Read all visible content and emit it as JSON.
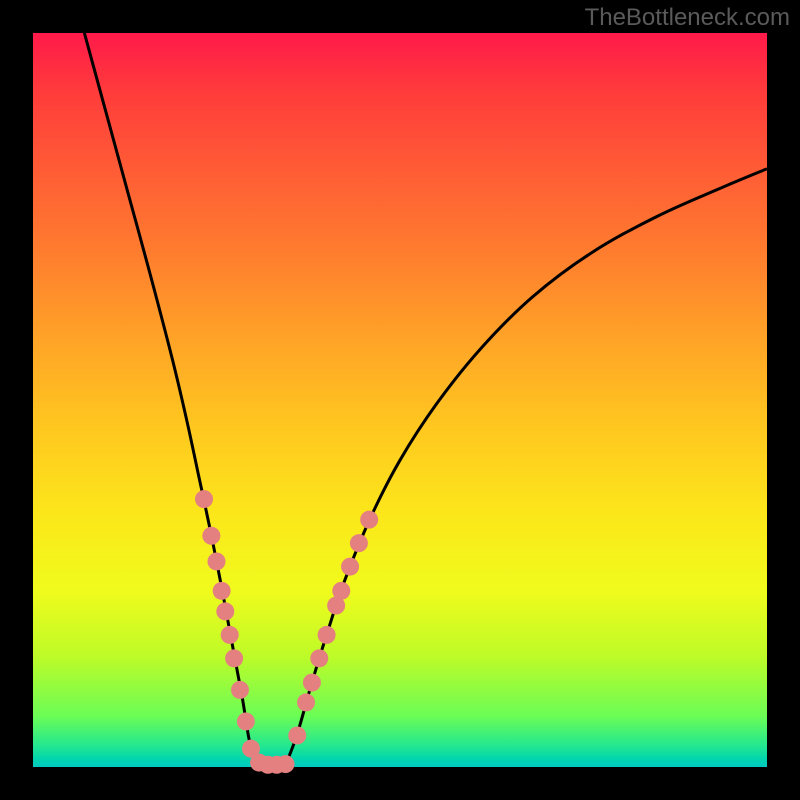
{
  "watermark": "TheBottleneck.com",
  "chart_data": {
    "type": "line",
    "title": "",
    "xlabel": "",
    "ylabel": "",
    "xlim": [
      0,
      1
    ],
    "ylim": [
      0,
      1
    ],
    "curve": {
      "left": [
        {
          "x": 0.07,
          "y": 1.0
        },
        {
          "x": 0.1,
          "y": 0.89
        },
        {
          "x": 0.13,
          "y": 0.78
        },
        {
          "x": 0.16,
          "y": 0.67
        },
        {
          "x": 0.19,
          "y": 0.555
        },
        {
          "x": 0.21,
          "y": 0.47
        },
        {
          "x": 0.225,
          "y": 0.4
        },
        {
          "x": 0.24,
          "y": 0.33
        },
        {
          "x": 0.255,
          "y": 0.255
        },
        {
          "x": 0.27,
          "y": 0.175
        },
        {
          "x": 0.285,
          "y": 0.095
        },
        {
          "x": 0.295,
          "y": 0.035
        },
        {
          "x": 0.305,
          "y": 0.005
        }
      ],
      "right": [
        {
          "x": 0.345,
          "y": 0.005
        },
        {
          "x": 0.36,
          "y": 0.045
        },
        {
          "x": 0.38,
          "y": 0.115
        },
        {
          "x": 0.4,
          "y": 0.18
        },
        {
          "x": 0.425,
          "y": 0.255
        },
        {
          "x": 0.46,
          "y": 0.34
        },
        {
          "x": 0.5,
          "y": 0.418
        },
        {
          "x": 0.55,
          "y": 0.495
        },
        {
          "x": 0.61,
          "y": 0.57
        },
        {
          "x": 0.68,
          "y": 0.64
        },
        {
          "x": 0.76,
          "y": 0.7
        },
        {
          "x": 0.85,
          "y": 0.75
        },
        {
          "x": 0.94,
          "y": 0.79
        },
        {
          "x": 1.0,
          "y": 0.815
        }
      ],
      "flat_bottom": {
        "x1": 0.305,
        "x2": 0.345,
        "y": 0.003
      }
    },
    "dots_left": [
      {
        "x": 0.233,
        "y": 0.365
      },
      {
        "x": 0.243,
        "y": 0.315
      },
      {
        "x": 0.25,
        "y": 0.28
      },
      {
        "x": 0.257,
        "y": 0.24
      },
      {
        "x": 0.262,
        "y": 0.212
      },
      {
        "x": 0.268,
        "y": 0.18
      },
      {
        "x": 0.274,
        "y": 0.148
      },
      {
        "x": 0.282,
        "y": 0.105
      },
      {
        "x": 0.29,
        "y": 0.062
      },
      {
        "x": 0.297,
        "y": 0.025
      },
      {
        "x": 0.308,
        "y": 0.006
      },
      {
        "x": 0.32,
        "y": 0.003
      },
      {
        "x": 0.332,
        "y": 0.003
      },
      {
        "x": 0.344,
        "y": 0.004
      }
    ],
    "dots_right": [
      {
        "x": 0.36,
        "y": 0.043
      },
      {
        "x": 0.372,
        "y": 0.088
      },
      {
        "x": 0.38,
        "y": 0.115
      },
      {
        "x": 0.39,
        "y": 0.148
      },
      {
        "x": 0.4,
        "y": 0.18
      },
      {
        "x": 0.413,
        "y": 0.22
      },
      {
        "x": 0.42,
        "y": 0.24
      },
      {
        "x": 0.432,
        "y": 0.273
      },
      {
        "x": 0.444,
        "y": 0.305
      },
      {
        "x": 0.458,
        "y": 0.337
      }
    ],
    "dot_color": "#e58080",
    "dot_radius_px": 9
  }
}
